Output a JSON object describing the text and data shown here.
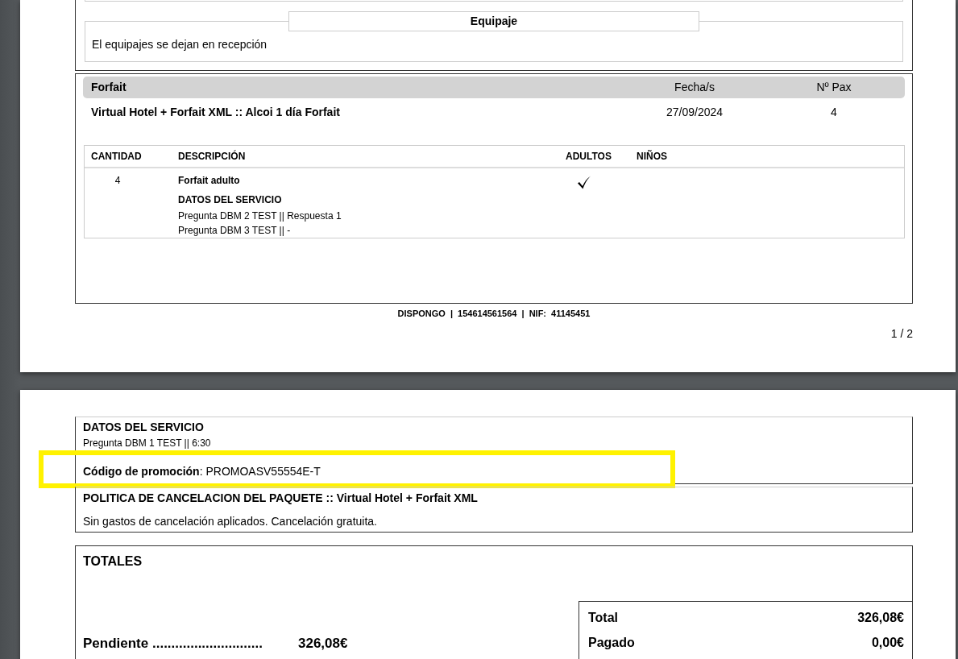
{
  "page_1": {
    "luggage": {
      "legend": "Equipaje",
      "text": "El equipajes se dejan en recepción"
    },
    "forfait": {
      "header": {
        "title": "Forfait",
        "dates": "Fecha/s",
        "pax": "Nº Pax"
      },
      "row": {
        "name": "Virtual Hotel + Forfait XML :: Alcoi 1 día Forfait",
        "date": "27/09/2024",
        "pax": "4"
      },
      "table": {
        "columns": [
          "CANTIDAD",
          "DESCRIPCIÓN",
          "ADULTOS",
          "NIÑOS"
        ],
        "rows": [
          {
            "quantity": "4",
            "description": "Forfait adulto",
            "adults": true,
            "service_title": "DATOS DEL SERVICIO",
            "service_lines": [
              "Pregunta DBM 2 TEST || Respuesta 1",
              "Pregunta DBM 3 TEST || -"
            ]
          }
        ]
      }
    },
    "footer": "DISPONGO | 154614561564 | NIF: 41145451",
    "page_number": "1 / 2"
  },
  "page_2": {
    "service": {
      "title": "DATOS DEL SERVICIO",
      "lines": [
        "Pregunta DBM 1 TEST || 6:30"
      ],
      "promo": "**Código de promoción**: PROMOASV55554E-T",
      "promo_highlighted": true
    },
    "cancellation": {
      "title": "POLITICA DE CANCELACION DEL PAQUETE :: Virtual Hotel + Forfait XML",
      "text": "Sin gastos de cancelación aplicados. Cancelación gratuita."
    },
    "totals": {
      "title": "TOTALES",
      "pending": {
        "label": "Pendiente .............................",
        "value": "326,08€"
      },
      "summary": [
        {
          "label": "Total",
          "value": "326,08€"
        },
        {
          "label": "Pagado",
          "value": "0,00€"
        }
      ]
    }
  }
}
